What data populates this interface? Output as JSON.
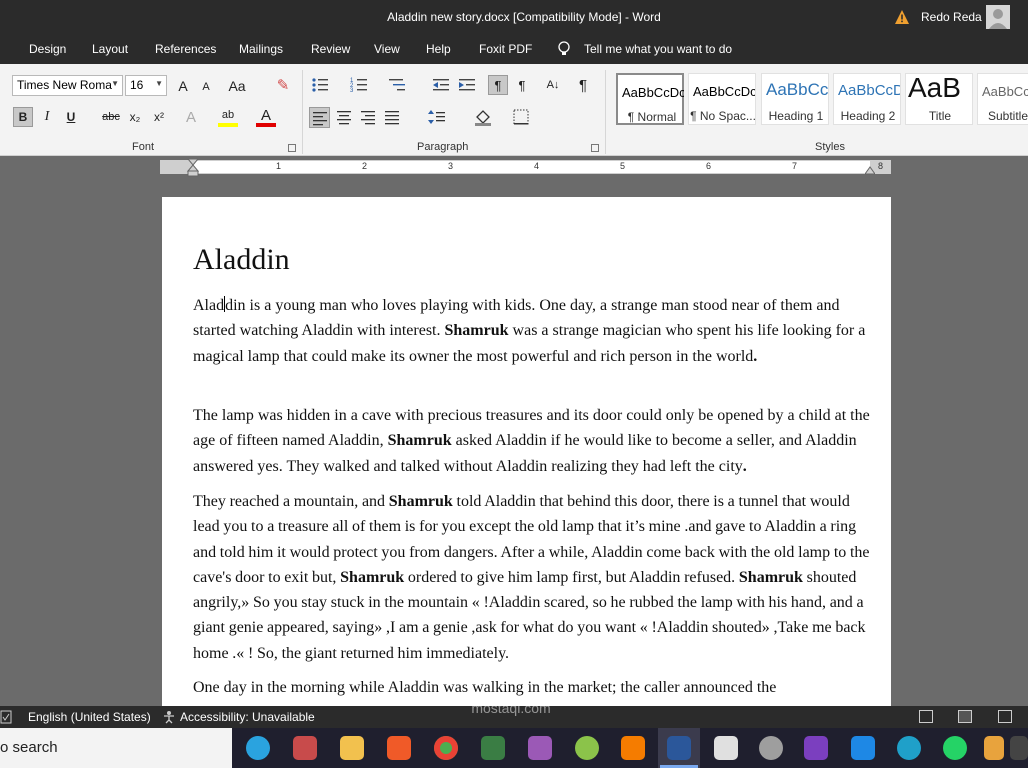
{
  "titlebar": {
    "title": "Aladdin new story.docx [Compatibility Mode]  -  Word",
    "user": "Redo Reda"
  },
  "menu": {
    "tabs": [
      "Design",
      "Layout",
      "References",
      "Mailings",
      "Review",
      "View",
      "Help",
      "Foxit PDF"
    ],
    "tell_me": "Tell me what you want to do"
  },
  "ribbon": {
    "font_name": "Times New Roma",
    "font_size": "16",
    "groups": {
      "font": "Font",
      "paragraph": "Paragraph",
      "styles": "Styles"
    },
    "styles": [
      {
        "preview": "AaBbCcDc",
        "label": "¶ Normal"
      },
      {
        "preview": "AaBbCcDc",
        "label": "¶ No Spac..."
      },
      {
        "preview": "AaBbCc",
        "label": "Heading 1"
      },
      {
        "preview": "AaBbCcD",
        "label": "Heading 2"
      },
      {
        "preview": "AaB",
        "label": "Title"
      },
      {
        "preview": "AaBbCcD",
        "label": "Subtitle"
      }
    ],
    "icons": {
      "grow": "A",
      "shrink": "A",
      "case": "Aa",
      "bold": "B",
      "italic": "I",
      "underline": "U",
      "strike": "abc",
      "sub": "x₂",
      "sup": "x²",
      "effects": "A",
      "font_color": "A",
      "pilcrow": "¶"
    }
  },
  "ruler": {
    "numbers": [
      "1",
      "2",
      "3",
      "4",
      "5",
      "6",
      "7",
      "8"
    ]
  },
  "document": {
    "title": "Aladdin",
    "p1a": "Alad",
    "p1b": "din is a young man who loves playing with kids. One day, a strange man stood near of them and started watching Aladdin with interest. ",
    "p1c": "Shamruk",
    "p1d": " was a strange magician who spent his life looking for a magical lamp that could make its owner the most powerful and rich person in the world",
    "p1e": ".",
    "p2a": "The lamp was hidden in a cave with precious treasures and its door could only be opened by a child at the age of fifteen named Aladdin, ",
    "p2b": "Shamruk",
    "p2c": " asked Aladdin if he would like to become a seller, and Aladdin answered yes. They walked and talked without Aladdin realizing they had left the city",
    "p2d": ".",
    "p3a": "They reached a mountain, and ",
    "p3b": "Shamruk",
    "p3c": " told Aladdin that behind this door, there is a tunnel that would lead you to a treasure all of them is for you except the old lamp that it’s mine .and gave to Aladdin a ring and told him it would protect you from dangers. After a while, Aladdin come back with the old lamp to the cave's door to exit but, ",
    "p3d": "Shamruk",
    "p3e": " ordered to give him lamp first, but Aladdin refused. ",
    "p3f": "Shamruk",
    "p3g": " shouted angrily,» So you stay stuck in the mountain « !Aladdin scared, so he rubbed the lamp with his hand, and a giant genie appeared, saying» ,I am a genie ,ask for what do you want « !Aladdin shouted» ,Take me back home .« ! So, the giant returned him immediately.",
    "p4": "One day in the morning while Aladdin was walking in the market; the caller announced the"
  },
  "statusbar": {
    "language": "English (United States)",
    "accessibility": "Accessibility: Unavailable"
  },
  "taskbar": {
    "search": "o search",
    "watermark": "mostaql.com"
  },
  "colors": {
    "titlebar": "#2b2b2b",
    "ribbon": "#f3f3f3",
    "highlight": "#ffff00",
    "font_color": "#e00000"
  }
}
